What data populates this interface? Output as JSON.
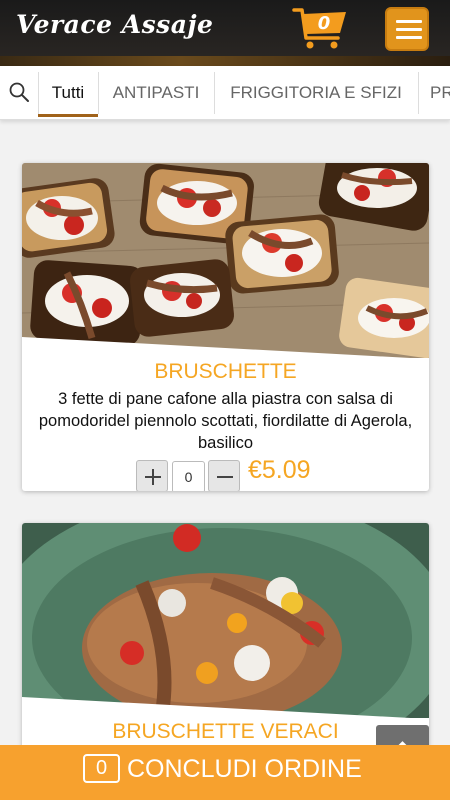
{
  "header": {
    "logo_text": "Verace Assaje",
    "cart_count": "0",
    "cart_icon": "shopping-cart-icon",
    "menu_icon": "hamburger-menu-icon"
  },
  "tabs": [
    {
      "label": "Tutti",
      "active": true
    },
    {
      "label": "ANTIPASTI",
      "active": false
    },
    {
      "label": "FRIGGITORIA E SFIZI",
      "active": false
    },
    {
      "label": "PR",
      "active": false
    }
  ],
  "products": [
    {
      "title": "BRUSCHETTE",
      "description": "3 fette di pane cafone alla piastra con salsa di pomodoridel piennolo scottati, fiordilatte di Agerola, basilico",
      "quantity": "0",
      "price": "€5.09"
    },
    {
      "title": "BRUSCHETTE VERACI"
    }
  ],
  "order_bar": {
    "count": "0",
    "label": "CONCLUDI ORDINE"
  },
  "colors": {
    "accent": "#f5a623",
    "header_bg": "#1e1c1a",
    "menu_button": "#e1941c",
    "order_bar": "#f7a12e",
    "tab_underline": "#a0621a"
  }
}
